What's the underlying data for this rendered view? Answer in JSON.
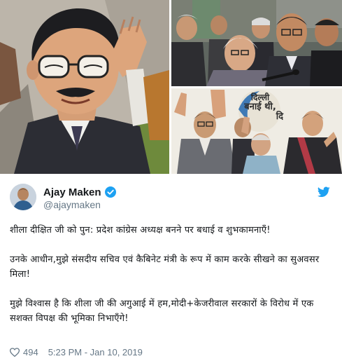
{
  "tweet": {
    "display_name": "Ajay Maken",
    "handle": "@ajaymaken",
    "paragraphs": [
      "शीला दीक्षित जी को पुन: प्रदेश कांग्रेस अध्यक्ष बनने पर बधाई व शुभकामनाएँ!",
      "उनके आधीन,मुझे संसदीय सचिव एवं कैबिनेट मंत्री के रूप में काम करके सीखने का सुअवसर मिला!",
      "मुझे विश्वास है कि शीला जी की अगुआई में हम,मोदी+केजरीवाल सरकारों के विरोध में एक सशक्त विपक्ष की भूमिका निभाएँगे!"
    ],
    "like_count": "494",
    "timestamp": "5:23 PM - Jan 10, 2019",
    "poster_text": {
      "line1": "दिल्ली",
      "line2": "बनाई थी,",
      "line3": "दि"
    }
  },
  "icons": {
    "verified": "verified-badge-icon",
    "platform": "twitter-bird-icon",
    "like": "heart-icon"
  },
  "colors": {
    "verified_blue": "#1da1f2",
    "twitter_blue": "#1da1f2",
    "text_primary": "#14171a",
    "text_secondary": "#657786"
  }
}
